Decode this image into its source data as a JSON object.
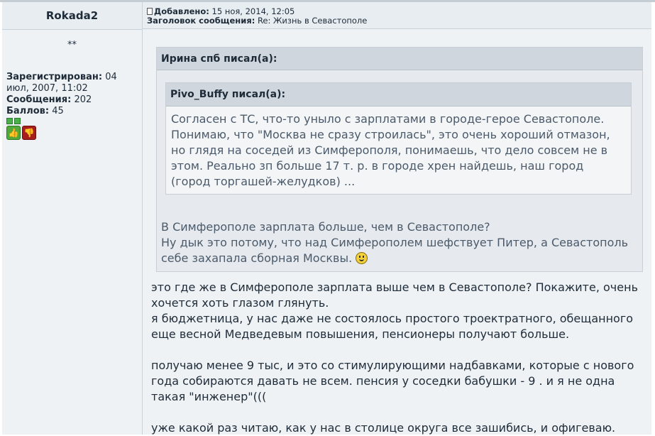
{
  "author": {
    "name": "Rokada2",
    "rank": "**",
    "registered_label": "Зарегистрирован:",
    "registered_value": " 04 июл, 2007, 11:02",
    "posts_label": "Сообщения:",
    "posts_value": " 202",
    "points_label": "Баллов:",
    "points_value": " 45",
    "thumb_up": "👍",
    "thumb_down": "👎"
  },
  "post": {
    "added_label": "Добавлено:",
    "added_value": " 15 ноя, 2014, 12:05",
    "subject_label": "Заголовок сообщения:",
    "subject_value": " Re: Жизнь в Севастополе",
    "quote_outer_title": "Ирина спб писал(а):",
    "quote_inner_title": "Pivo_Buffy писал(а):",
    "quote_inner_text": "Согласен с ТС, что-то уныло с зарплатами в городе-герое Севастополе. Понимаю, что \"Москва не сразу строилась\", это очень хороший отмазон, но глядя на соседей из Симферополя, понимаешь, что дело совсем не в этом. Реально зп больше 17 т. р. в городе хрен найдешь, наш город (город торгашей-желудков) ...",
    "quote_outer_line1": "В Симферополе зарплата больше, чем в Севастополе?",
    "quote_outer_line2": "Ну дык это потому, что над Симферополем шефствует Питер, а Севастополь себе захапала сборная Москвы.",
    "body_p1": "это где же в Симферополе зарплата выше чем в Севастополе? Покажите, очень хочется хоть глазом глянуть.",
    "body_p2": "я бюджетница, у нас даже не состоялось простого троектратного, обещанного еще весной Медведевым повышения, пенсионеры получают больше.",
    "body_p3": "получаю менее 9 тыс, и это со стимулирующими надбавками, которые с нового года собираются давать не всем. пенсия у соседки бабушки - 9 . и я не одна такая \"инженер\"(((",
    "body_p4": "уже какой раз читаю, как у нас в столице округа все зашибись, и офигеваю."
  }
}
